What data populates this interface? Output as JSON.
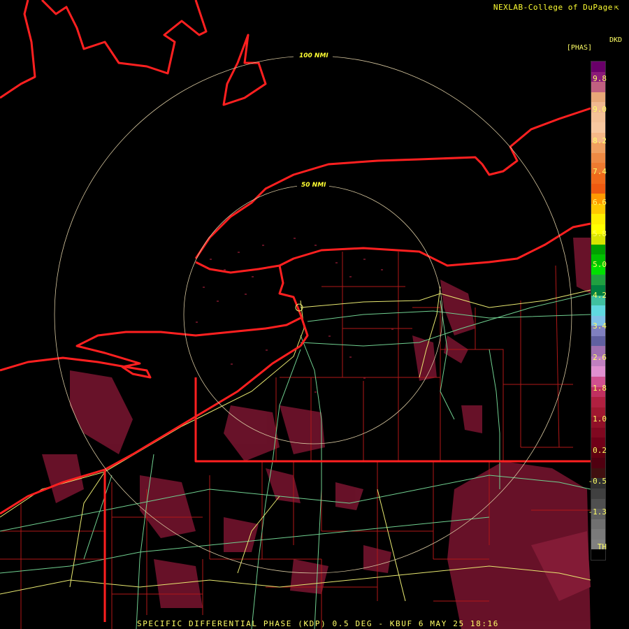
{
  "credit": "NEXLAB-College of DuPage",
  "credit_icon": "cursor-arrow-icon",
  "product_code": "DKD",
  "units": "[PHAS]",
  "footer": "SPECIFIC DIFFERENTIAL PHASE (KDP) 0.5 DEG - KBUF 6 MAY 25 18:16",
  "range_rings": [
    {
      "label": "100 NMI",
      "range_nmi": 100
    },
    {
      "label": "50 NMI",
      "range_nmi": 50
    }
  ],
  "legend": {
    "ticks": [
      "9.8",
      "9.0",
      "8.2",
      "7.4",
      "6.6",
      "5.8",
      "5.0",
      "4.2",
      "3.4",
      "2.6",
      "1.8",
      "1.0",
      "0.2",
      "-0.5",
      "-1.3",
      "TH"
    ],
    "colors": [
      "#6a006a",
      "#8a1a7a",
      "#c06080",
      "#e8a878",
      "#f0b890",
      "#f5c298",
      "#f8c8a0",
      "#f6b888",
      "#f0a060",
      "#ee8a44",
      "#ee7a30",
      "#f06a1a",
      "#ee5a10",
      "#ff9a00",
      "#ffc800",
      "#ffee00",
      "#ffff00",
      "#d8e400",
      "#00a000",
      "#00c000",
      "#00e000",
      "#20a040",
      "#008040",
      "#40c0a0",
      "#60d8e0",
      "#80c0e8",
      "#8080c0",
      "#6060a0",
      "#a070b0",
      "#c080c0",
      "#e090d0",
      "#d05090",
      "#c03060",
      "#b02040",
      "#a01830",
      "#901028",
      "#800820",
      "#700018",
      "#600010",
      "#500010",
      "#401010",
      "#303030",
      "#404040",
      "#505050",
      "#606060",
      "#707070",
      "#7a7a7a",
      "#808080",
      "#000000"
    ]
  },
  "colors": {
    "state_borders": "#ff2020",
    "county_lines": "#b01818",
    "highways": "#e8e870",
    "roads": "#70d090",
    "ring": "#d8c8a0",
    "echo": "#8a1a32"
  }
}
